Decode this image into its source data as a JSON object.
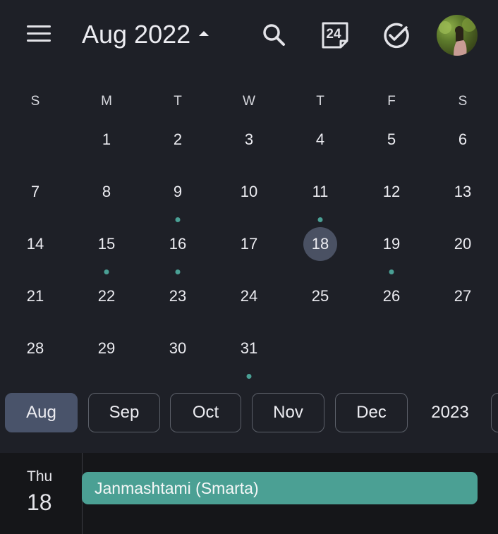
{
  "header": {
    "title": "Aug 2022",
    "today_number": "24"
  },
  "calendar": {
    "weekdays": [
      "S",
      "M",
      "T",
      "W",
      "T",
      "F",
      "S"
    ],
    "weeks": [
      [
        {
          "d": ""
        },
        {
          "d": "1"
        },
        {
          "d": "2"
        },
        {
          "d": "3"
        },
        {
          "d": "4"
        },
        {
          "d": "5"
        },
        {
          "d": "6"
        }
      ],
      [
        {
          "d": "7"
        },
        {
          "d": "8"
        },
        {
          "d": "9",
          "dot": true
        },
        {
          "d": "10"
        },
        {
          "d": "11",
          "dot": true
        },
        {
          "d": "12"
        },
        {
          "d": "13"
        }
      ],
      [
        {
          "d": "14"
        },
        {
          "d": "15",
          "dot": true
        },
        {
          "d": "16",
          "dot": true
        },
        {
          "d": "17"
        },
        {
          "d": "18",
          "today": true
        },
        {
          "d": "19",
          "dot": true
        },
        {
          "d": "20"
        }
      ],
      [
        {
          "d": "21"
        },
        {
          "d": "22"
        },
        {
          "d": "23"
        },
        {
          "d": "24"
        },
        {
          "d": "25"
        },
        {
          "d": "26"
        },
        {
          "d": "27"
        }
      ],
      [
        {
          "d": "28"
        },
        {
          "d": "29"
        },
        {
          "d": "30"
        },
        {
          "d": "31",
          "dot": true
        },
        {
          "d": ""
        },
        {
          "d": ""
        },
        {
          "d": ""
        }
      ]
    ],
    "dot_color": "#4aa095"
  },
  "month_chips": [
    {
      "label": "Aug",
      "selected": true
    },
    {
      "label": "Sep"
    },
    {
      "label": "Oct"
    },
    {
      "label": "Nov"
    },
    {
      "label": "Dec"
    },
    {
      "label": "2023",
      "plain": true
    }
  ],
  "agenda": {
    "weekday": "Thu",
    "day": "18",
    "event_title": "Janmashtami (Smarta)",
    "event_color": "#4ba094"
  }
}
